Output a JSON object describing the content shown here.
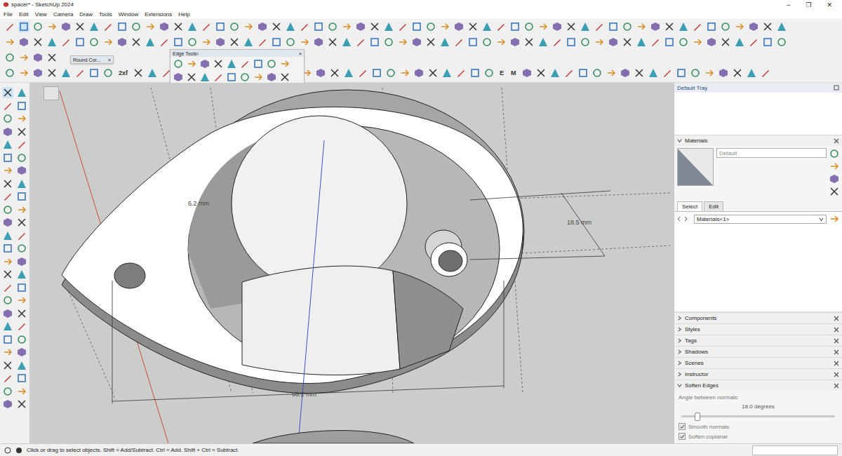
{
  "window": {
    "title": "spacer* - SketchUp 2024",
    "controls": [
      "–",
      "❐",
      "✕"
    ]
  },
  "menu": [
    "File",
    "Edit",
    "View",
    "Camera",
    "Draw",
    "Tools",
    "Window",
    "Extensions",
    "Help"
  ],
  "toolbars": {
    "labels": [
      "2xf",
      "E",
      "M"
    ],
    "floating": [
      {
        "title": "Round Cor...",
        "close": "×"
      },
      {
        "title": "Edge Tools²",
        "close": "×"
      }
    ]
  },
  "viewport": {
    "dimensions": [
      "6.2 mm",
      "18.5 mm",
      "66.2 mm"
    ]
  },
  "tray": {
    "title": "Default Tray",
    "materials": {
      "title": "Materials",
      "name": "Default",
      "tabs": [
        {
          "label": "Select",
          "selected": true
        },
        {
          "label": "Edit",
          "selected": false
        }
      ],
      "collection": "Materials<1>"
    },
    "panels": [
      {
        "title": "Components",
        "expanded": false
      },
      {
        "title": "Styles",
        "expanded": false
      },
      {
        "title": "Tags",
        "expanded": false
      },
      {
        "title": "Shadows",
        "expanded": false
      },
      {
        "title": "Scenes",
        "expanded": false
      },
      {
        "title": "Instructor",
        "expanded": false
      }
    ],
    "soften_edges": {
      "title": "Soften Edges",
      "expanded": true,
      "angle_label": "Angle between normals:",
      "angle": "18.0  degrees",
      "level": 0.1,
      "options": [
        {
          "label": "Smooth normals",
          "checked": true
        },
        {
          "label": "Soften coplanar",
          "checked": true
        }
      ]
    }
  },
  "status_bar": {
    "text": "Click or drag to select objects. Shift = Add/Subtract. Ctrl = Add. Shift + Ctrl = Subtract."
  }
}
